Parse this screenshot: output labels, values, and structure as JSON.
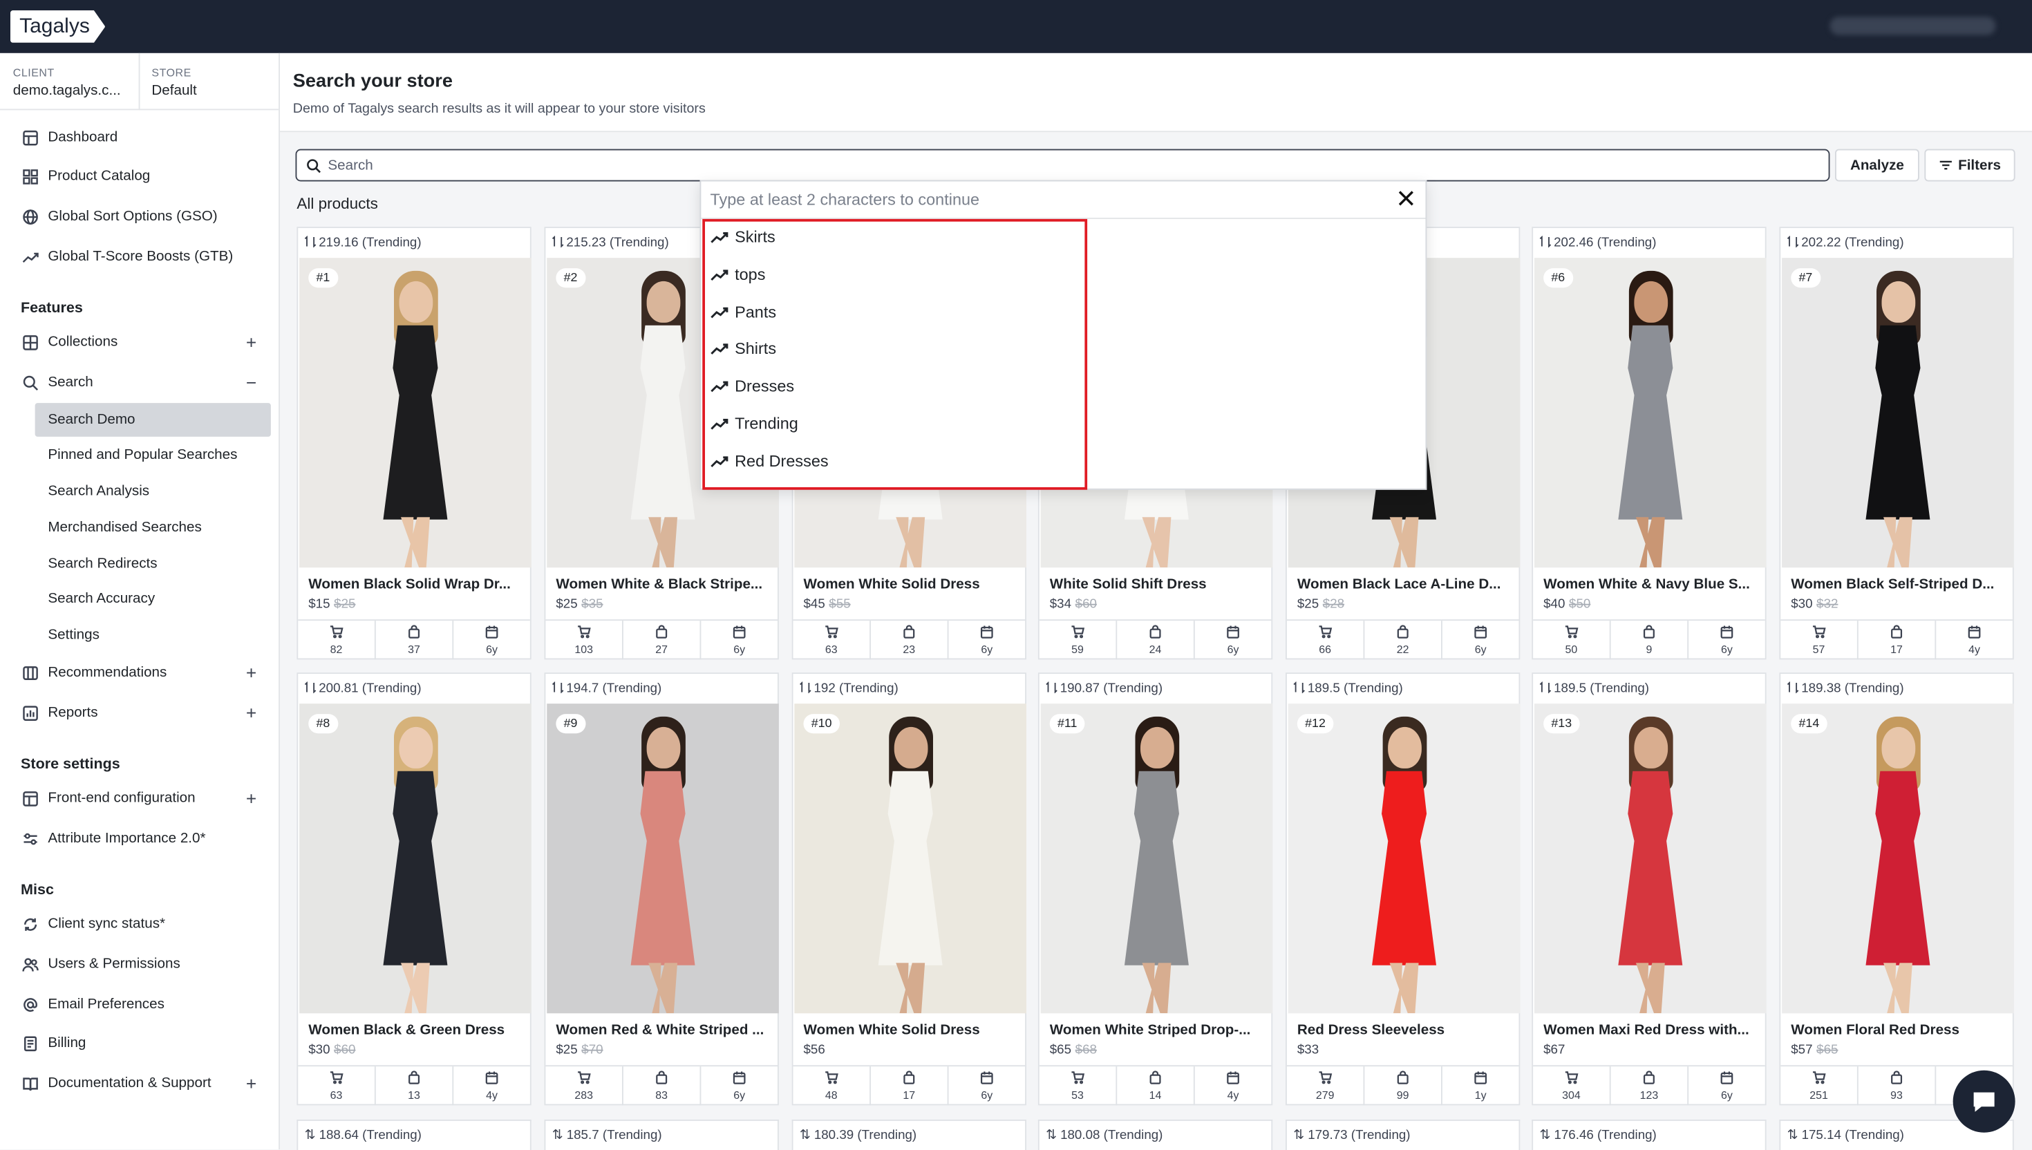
{
  "app": {
    "logo": "Tagalys"
  },
  "context": {
    "client_label": "CLIENT",
    "client_value": "demo.tagalys.c...",
    "store_label": "STORE",
    "store_value": "Default"
  },
  "sidebar": {
    "top_items": [
      {
        "label": "Dashboard",
        "icon": "dashboard-icon"
      },
      {
        "label": "Product Catalog",
        "icon": "grid-icon"
      },
      {
        "label": "Global Sort Options (GSO)",
        "icon": "globe-icon"
      },
      {
        "label": "Global T-Score Boosts (GTB)",
        "icon": "trend-icon"
      }
    ],
    "features_heading": "Features",
    "features": [
      {
        "label": "Collections",
        "icon": "collections-icon",
        "toggle": "+"
      },
      {
        "label": "Search",
        "icon": "search-icon",
        "toggle": "−"
      }
    ],
    "search_sub": [
      "Search Demo",
      "Pinned and Popular Searches",
      "Search Analysis",
      "Merchandised Searches",
      "Search Redirects",
      "Search Accuracy",
      "Settings"
    ],
    "features_more": [
      {
        "label": "Recommendations",
        "icon": "recommendations-icon",
        "toggle": "+"
      },
      {
        "label": "Reports",
        "icon": "reports-icon",
        "toggle": "+"
      }
    ],
    "store_heading": "Store settings",
    "store_items": [
      {
        "label": "Front-end configuration",
        "icon": "layout-icon",
        "toggle": "+"
      },
      {
        "label": "Attribute Importance 2.0*",
        "icon": "sliders-icon"
      }
    ],
    "misc_heading": "Misc",
    "misc_items": [
      {
        "label": "Client sync status*",
        "icon": "sync-icon"
      },
      {
        "label": "Users & Permissions",
        "icon": "users-icon"
      },
      {
        "label": "Email Preferences",
        "icon": "at-icon"
      },
      {
        "label": "Billing",
        "icon": "billing-icon"
      },
      {
        "label": "Documentation & Support",
        "icon": "book-icon",
        "toggle": "+"
      }
    ]
  },
  "header": {
    "title": "Search your store",
    "subtitle": "Demo of Tagalys search results as it will appear to your store visitors"
  },
  "search": {
    "placeholder": "Search",
    "value": "",
    "analyze_label": "Analyze",
    "filters_label": "Filters"
  },
  "all_products_label": "All products",
  "dropdown": {
    "hint": "Type at least 2 characters to continue",
    "suggestions": [
      "Skirts",
      "tops",
      "Pants",
      "Shirts",
      "Dresses",
      "Trending",
      "Red Dresses"
    ]
  },
  "products": [
    {
      "score": "219.16 (Trending)",
      "rank": "#1",
      "name": "Women Black Solid Wrap Dr...",
      "price": "$15",
      "old_price": "$25",
      "carts": "82",
      "orders": "37",
      "age": "6y",
      "dress": "#1d1d1f",
      "bg": "#ebe9e6",
      "skin": "#e8c5a8",
      "hair": "#c9a26c"
    },
    {
      "score": "215.23 (Trending)",
      "rank": "#2",
      "name": "Women White & Black Stripe...",
      "price": "$25",
      "old_price": "$35",
      "carts": "103",
      "orders": "27",
      "age": "6y",
      "dress": "#f3f3f1",
      "bg": "#e9e8e6",
      "skin": "#d9b59a",
      "hair": "#3a2a22"
    },
    {
      "score": "",
      "rank": "",
      "name": "Women White Solid Dress",
      "price": "$45",
      "old_price": "$55",
      "carts": "63",
      "orders": "23",
      "age": "6y",
      "dress": "#f6f6f4",
      "bg": "#eceae7",
      "skin": "#e2bfa4",
      "hair": "#5b4030"
    },
    {
      "score": "",
      "rank": "",
      "name": "White Solid Shift Dress",
      "price": "$34",
      "old_price": "$60",
      "carts": "59",
      "orders": "24",
      "age": "6y",
      "dress": "#f7f7f5",
      "bg": "#ebebe9",
      "skin": "#e6c4ab",
      "hair": "#4a3326"
    },
    {
      "score": "",
      "rank": "",
      "name": "Women Black Lace A-Line D...",
      "price": "$25",
      "old_price": "$28",
      "carts": "66",
      "orders": "22",
      "age": "6y",
      "dress": "#161616",
      "bg": "#e7e7e5",
      "skin": "#dfba9c",
      "hair": "#2a1d17"
    },
    {
      "score": "202.46 (Trending)",
      "rank": "#6",
      "name": "Women White & Navy Blue S...",
      "price": "$40",
      "old_price": "$50",
      "carts": "50",
      "orders": "9",
      "age": "6y",
      "dress": "#8c8f96",
      "bg": "#ececea",
      "skin": "#c99674",
      "hair": "#2a1a12"
    },
    {
      "score": "202.22 (Trending)",
      "rank": "#7",
      "name": "Women Black Self-Striped D...",
      "price": "$30",
      "old_price": "$32",
      "carts": "57",
      "orders": "17",
      "age": "4y",
      "dress": "#111113",
      "bg": "#e8e8e8",
      "skin": "#e5c2a7",
      "hair": "#3b2a22"
    },
    {
      "score": "200.81 (Trending)",
      "rank": "#8",
      "name": "Women Black & Green Dress",
      "price": "$30",
      "old_price": "$60",
      "carts": "63",
      "orders": "13",
      "age": "4y",
      "dress": "#23262e",
      "bg": "#e6e6e4",
      "skin": "#eccbb2",
      "hair": "#d6b27a"
    },
    {
      "score": "194.7 (Trending)",
      "rank": "#9",
      "name": "Women Red & White Striped ...",
      "price": "$25",
      "old_price": "$70",
      "carts": "283",
      "orders": "83",
      "age": "6y",
      "dress": "#d9877d",
      "bg": "#cfcfd0",
      "skin": "#d8b095",
      "hair": "#2e211a"
    },
    {
      "score": "192 (Trending)",
      "rank": "#10",
      "name": "Women White Solid Dress",
      "price": "$56",
      "old_price": "",
      "carts": "48",
      "orders": "17",
      "age": "6y",
      "dress": "#f5f4ef",
      "bg": "#ebe8df",
      "skin": "#d5ab8e",
      "hair": "#2d211a"
    },
    {
      "score": "190.87 (Trending)",
      "rank": "#11",
      "name": "Women White Striped Drop-...",
      "price": "$65",
      "old_price": "$68",
      "carts": "53",
      "orders": "14",
      "age": "4y",
      "dress": "#8d8f93",
      "bg": "#ebebea",
      "skin": "#d7ad90",
      "hair": "#2a1c15"
    },
    {
      "score": "189.5 (Trending)",
      "rank": "#12",
      "name": "Red Dress Sleeveless",
      "price": "$33",
      "old_price": "",
      "carts": "279",
      "orders": "99",
      "age": "1y",
      "dress": "#ee1d1d",
      "bg": "#eeeeee",
      "skin": "#e3bc9e",
      "hair": "#3a2a20"
    },
    {
      "score": "189.5 (Trending)",
      "rank": "#13",
      "name": "Women Maxi Red Dress with...",
      "price": "$67",
      "old_price": "",
      "carts": "304",
      "orders": "123",
      "age": "6y",
      "dress": "#d6363e",
      "bg": "#ececec",
      "skin": "#d9ad8f",
      "hair": "#5a3a28"
    },
    {
      "score": "189.38 (Trending)",
      "rank": "#14",
      "name": "Women Floral Red Dress",
      "price": "$57",
      "old_price": "$65",
      "carts": "251",
      "orders": "93",
      "age": "",
      "dress": "#cf1f34",
      "bg": "#ececec",
      "skin": "#e8c6aa",
      "hair": "#c59a5e"
    }
  ],
  "next_row_scores": [
    "188.64 (Trending)",
    "185.7 (Trending)",
    "180.39 (Trending)",
    "180.08 (Trending)",
    "179.73 (Trending)",
    "176.46 (Trending)",
    "175.14 (Trending)"
  ]
}
